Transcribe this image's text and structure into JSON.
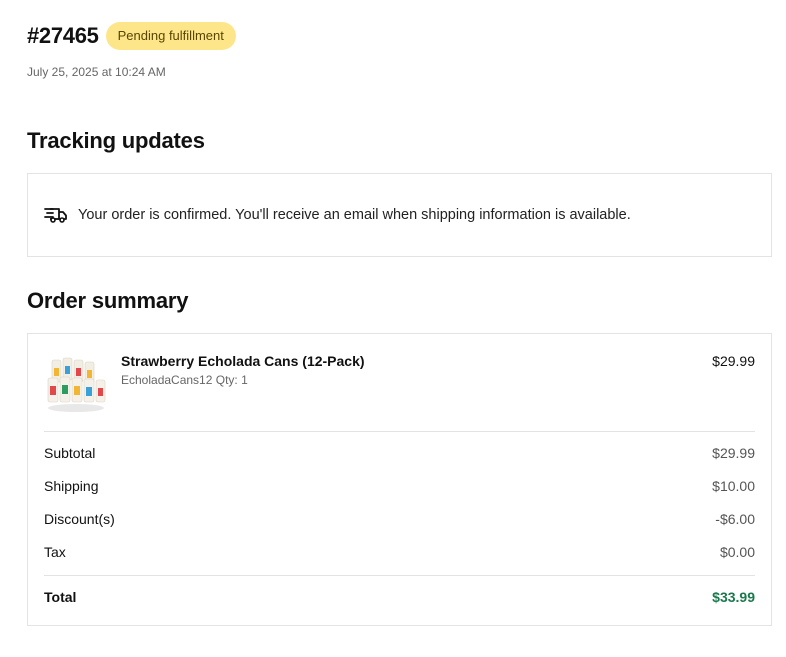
{
  "order": {
    "number": "#27465",
    "status": "Pending fulfillment",
    "date": "July 25, 2025 at 10:24 AM"
  },
  "tracking": {
    "title": "Tracking updates",
    "icon": "truck-icon",
    "message": "Your order is confirmed. You'll receive an email when shipping information is available."
  },
  "summary": {
    "title": "Order summary",
    "item": {
      "name": "Strawberry Echolada Cans (12-Pack)",
      "meta": "EcholadaCans12 Qty: 1",
      "price": "$29.99"
    },
    "lines": [
      {
        "label": "Subtotal",
        "value": "$29.99"
      },
      {
        "label": "Shipping",
        "value": "$10.00"
      },
      {
        "label": "Discount(s)",
        "value": "-$6.00"
      },
      {
        "label": "Tax",
        "value": "$0.00"
      }
    ],
    "total": {
      "label": "Total",
      "value": "$33.99"
    }
  },
  "colors": {
    "badge_bg": "#fde68a",
    "total_green": "#1a7a4c",
    "border": "#e3e3e3"
  }
}
